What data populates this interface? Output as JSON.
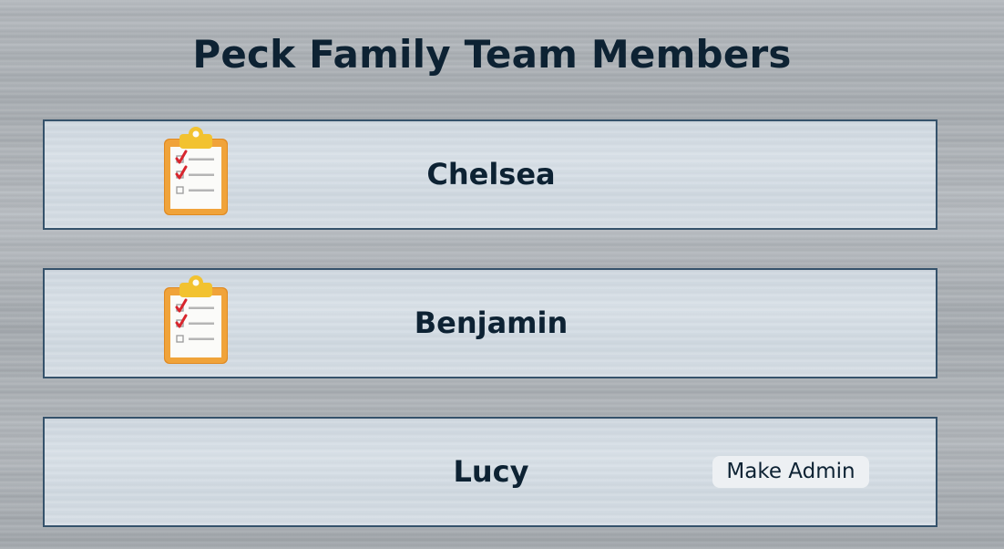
{
  "page": {
    "title": "Peck Family Team Members"
  },
  "members": [
    {
      "name": "Chelsea",
      "icon": "clipboard-checklist-icon"
    },
    {
      "name": "Benjamin",
      "icon": "clipboard-checklist-icon"
    },
    {
      "name": "Lucy",
      "action_label": "Make Admin"
    }
  ],
  "colors": {
    "text": "#0d2233",
    "card_border": "#35526b",
    "card_background": "#d5dde4",
    "button_background": "#edf0f3"
  }
}
